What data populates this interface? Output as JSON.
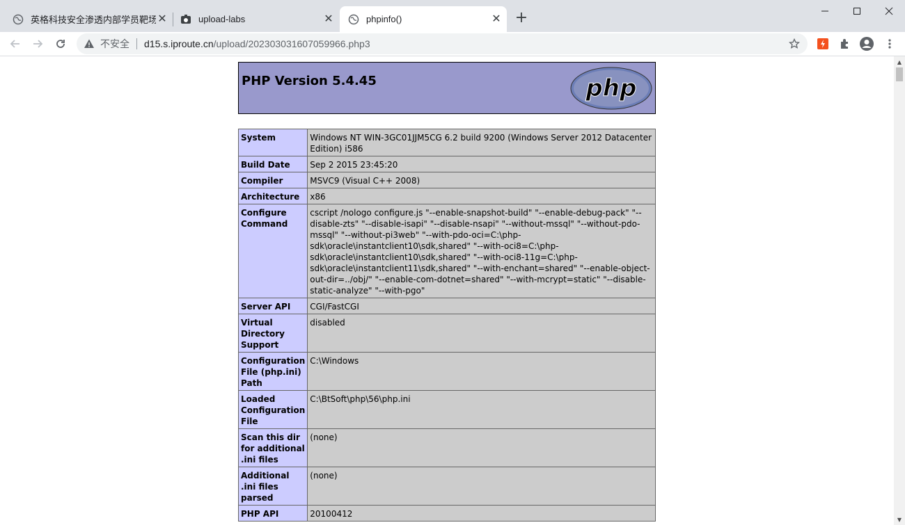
{
  "browser": {
    "tabs": [
      {
        "title": "英格科技安全渗透内部学员靶场",
        "active": false
      },
      {
        "title": "upload-labs",
        "active": false
      },
      {
        "title": "phpinfo()",
        "active": true
      }
    ],
    "address": {
      "insecure_label": "不安全",
      "host": "d15.s.iproute.cn",
      "path": "/upload/202303031607059966.php3"
    }
  },
  "page": {
    "heading": "PHP Version 5.4.45",
    "logo_text": "php",
    "rows": [
      {
        "key": "System",
        "value": "Windows NT WIN-3GC01JJM5CG 6.2 build 9200 (Windows Server 2012 Datacenter Edition) i586"
      },
      {
        "key": "Build Date",
        "value": "Sep 2 2015 23:45:20"
      },
      {
        "key": "Compiler",
        "value": "MSVC9 (Visual C++ 2008)"
      },
      {
        "key": "Architecture",
        "value": "x86"
      },
      {
        "key": "Configure Command",
        "value": "cscript /nologo configure.js \"--enable-snapshot-build\" \"--enable-debug-pack\" \"--disable-zts\" \"--disable-isapi\" \"--disable-nsapi\" \"--without-mssql\" \"--without-pdo-mssql\" \"--without-pi3web\" \"--with-pdo-oci=C:\\php-sdk\\oracle\\instantclient10\\sdk,shared\" \"--with-oci8=C:\\php-sdk\\oracle\\instantclient10\\sdk,shared\" \"--with-oci8-11g=C:\\php-sdk\\oracle\\instantclient11\\sdk,shared\" \"--with-enchant=shared\" \"--enable-object-out-dir=../obj/\" \"--enable-com-dotnet=shared\" \"--with-mcrypt=static\" \"--disable-static-analyze\" \"--with-pgo\""
      },
      {
        "key": "Server API",
        "value": "CGI/FastCGI"
      },
      {
        "key": "Virtual Directory Support",
        "value": "disabled"
      },
      {
        "key": "Configuration File (php.ini) Path",
        "value": "C:\\Windows"
      },
      {
        "key": "Loaded Configuration File",
        "value": "C:\\BtSoft\\php\\56\\php.ini"
      },
      {
        "key": "Scan this dir for additional .ini files",
        "value": "(none)"
      },
      {
        "key": "Additional .ini files parsed",
        "value": "(none)"
      },
      {
        "key": "PHP API",
        "value": "20100412"
      }
    ]
  }
}
